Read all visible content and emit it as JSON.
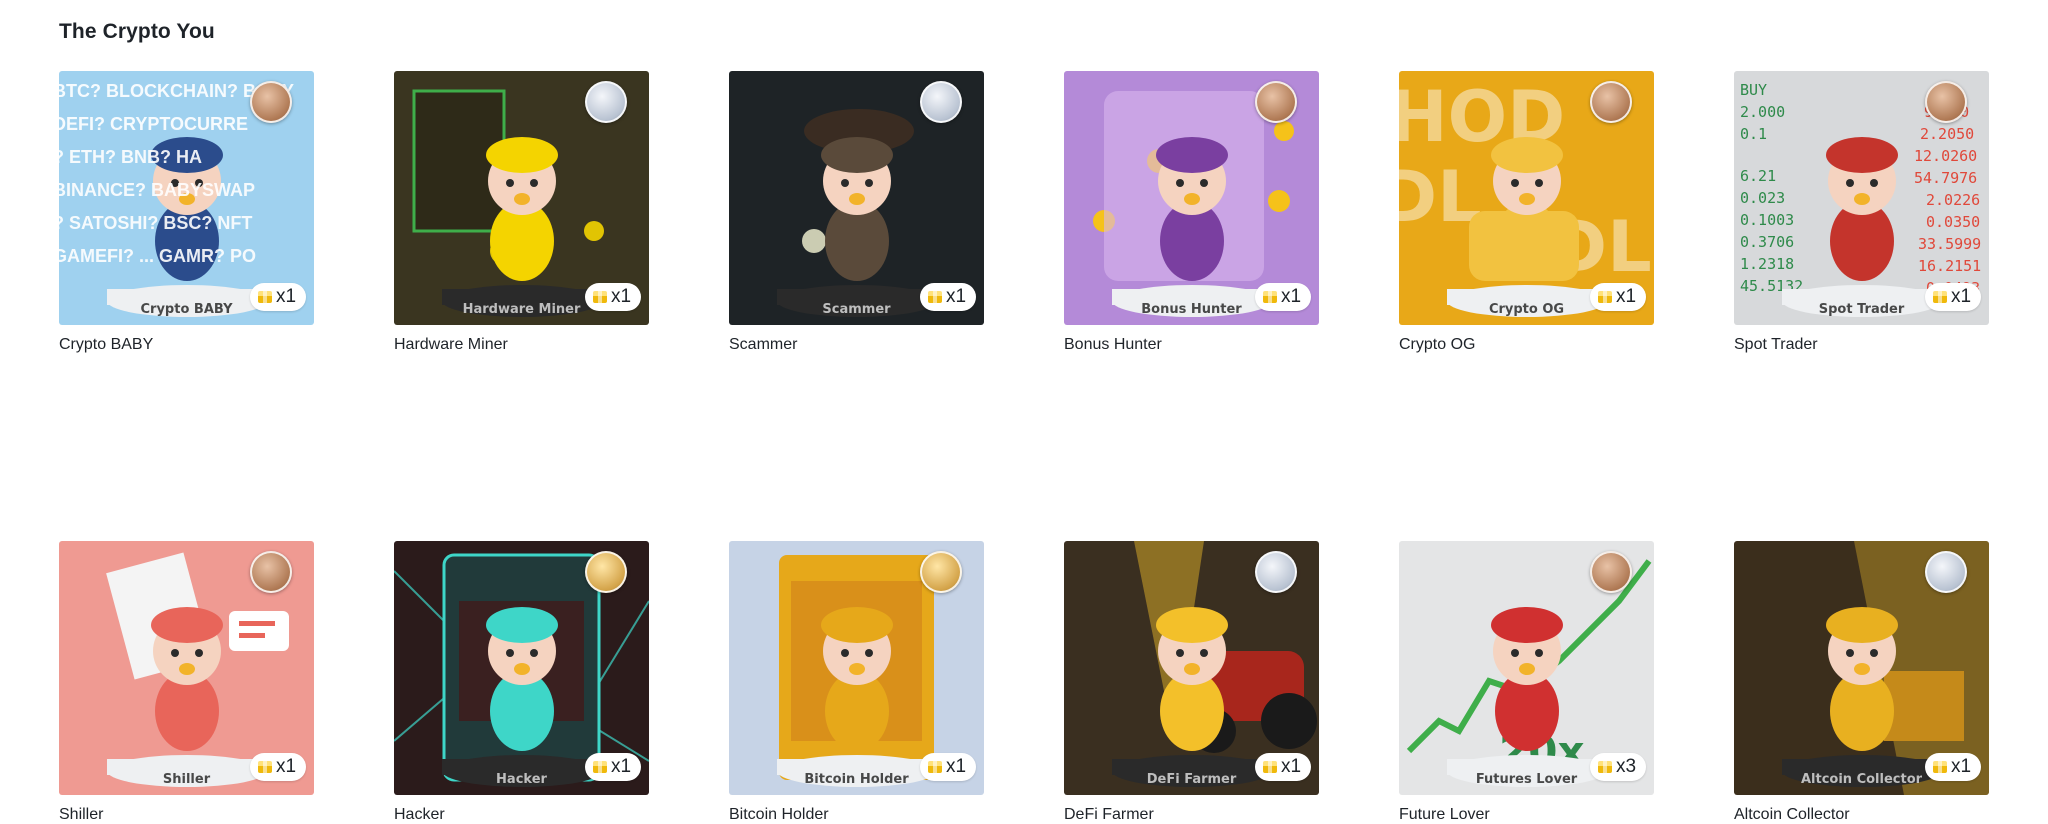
{
  "section": {
    "title": "The Crypto You"
  },
  "cards": [
    {
      "name": "Crypto BABY",
      "count": "x1",
      "plaque": "Crypto BABY",
      "bg": "#9fd1ef",
      "accent": "#2b4c8c",
      "badge": "bronze"
    },
    {
      "name": "Hardware Miner",
      "count": "x1",
      "plaque": "Hardware Miner",
      "bg": "#3a3520",
      "accent": "#f4d400",
      "badge": "silver"
    },
    {
      "name": "Scammer",
      "count": "x1",
      "plaque": "Scammer",
      "bg": "#1e2326",
      "accent": "#5a4a3a",
      "badge": "silver"
    },
    {
      "name": "Bonus Hunter",
      "count": "x1",
      "plaque": "Bonus Hunter",
      "bg": "#b48ad8",
      "accent": "#7a3fa0",
      "badge": "bronze"
    },
    {
      "name": "Crypto OG",
      "count": "x1",
      "plaque": "Crypto OG",
      "bg": "#e8a818",
      "accent": "#f2c240",
      "badge": "bronze"
    },
    {
      "name": "Spot Trader",
      "count": "x1",
      "plaque": "Spot Trader",
      "bg": "#d7d9db",
      "accent": "#c4342c",
      "badge": "bronze"
    },
    {
      "name": "Shiller",
      "count": "x1",
      "plaque": "Shiller",
      "bg": "#ef9a92",
      "accent": "#e8655a",
      "badge": "bronze"
    },
    {
      "name": "Hacker",
      "count": "x1",
      "plaque": "Hacker",
      "bg": "#2b1b1b",
      "accent": "#3ed6c8",
      "badge": "gold"
    },
    {
      "name": "Bitcoin Holder",
      "count": "x1",
      "plaque": "Bitcoin Holder",
      "bg": "#c6d3e6",
      "accent": "#e6a81a",
      "badge": "gold"
    },
    {
      "name": "DeFi Farmer",
      "count": "x1",
      "plaque": "DeFi Farmer",
      "bg": "#3a2f20",
      "accent": "#f3c02a",
      "badge": "silver"
    },
    {
      "name": "Future Lover",
      "count": "x3",
      "plaque": "Futures Lover",
      "bg": "#e4e5e6",
      "accent": "#d03030",
      "badge": "bronze"
    },
    {
      "name": "Altcoin Collector",
      "count": "x1",
      "plaque": "Altcoin Collector",
      "bg": "#3b2e1c",
      "accent": "#e8b020",
      "badge": "silver"
    }
  ],
  "card1_bg_words": [
    "BTC? BLOCKCHAIN? BABY",
    "DEFI? CRYPTOCURRE",
    "? ETH? BNB? HA",
    "BINANCE? BABYSWAP",
    "? SATOSHI? BSC? NFT",
    "GAMEFI? ... GAMR? PO"
  ]
}
